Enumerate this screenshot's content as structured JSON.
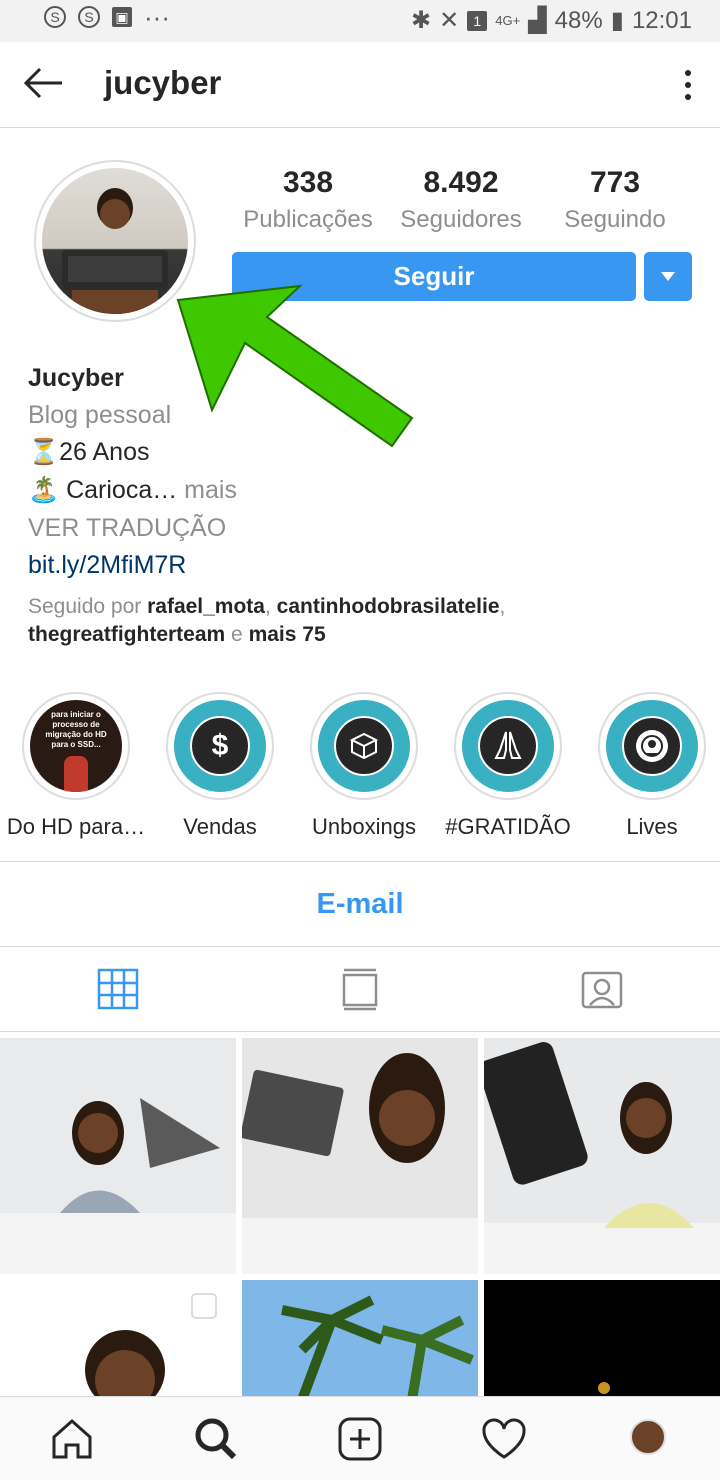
{
  "status": {
    "battery": "48%",
    "time": "12:01",
    "lte": "4G+",
    "sim": "1"
  },
  "topbar": {
    "username": "jucyber"
  },
  "stats": [
    {
      "value": "338",
      "label": "Publicações"
    },
    {
      "value": "8.492",
      "label": "Seguidores"
    },
    {
      "value": "773",
      "label": "Seguindo"
    }
  ],
  "follow_label": "Seguir",
  "bio": {
    "name": "Jucyber",
    "category": "Blog pessoal",
    "line1": "⏳26 Anos",
    "line2": "🏝️ Carioca…",
    "more": " mais",
    "translate": "VER TRADUÇÃO",
    "link": "bit.ly/2MfiM7R",
    "followed_prefix": "Seguido por ",
    "f1": "rafael_mota",
    "sep1": ", ",
    "f2": "cantinhodobrasilatelie",
    "sep2": ",",
    "f3": "thegreatfighterteam",
    "and": " e ",
    "more_count": "mais 75"
  },
  "highlights": [
    {
      "label": "Do HD para…",
      "icon": "photo-thumbnail",
      "thumb_text": "para iniciar o processo de migração do HD para o SSD..."
    },
    {
      "label": "Vendas",
      "icon": "dollar-icon",
      "glyph": "$"
    },
    {
      "label": "Unboxings",
      "icon": "box-icon"
    },
    {
      "label": "#GRATIDÃO",
      "icon": "praying-hands-icon"
    },
    {
      "label": "Lives",
      "icon": "live-broadcast-icon"
    }
  ],
  "email_label": "E-mail",
  "colors": {
    "accent": "#3897f0",
    "highlight": "#3ab0c3",
    "arrow": "#3fc700"
  }
}
